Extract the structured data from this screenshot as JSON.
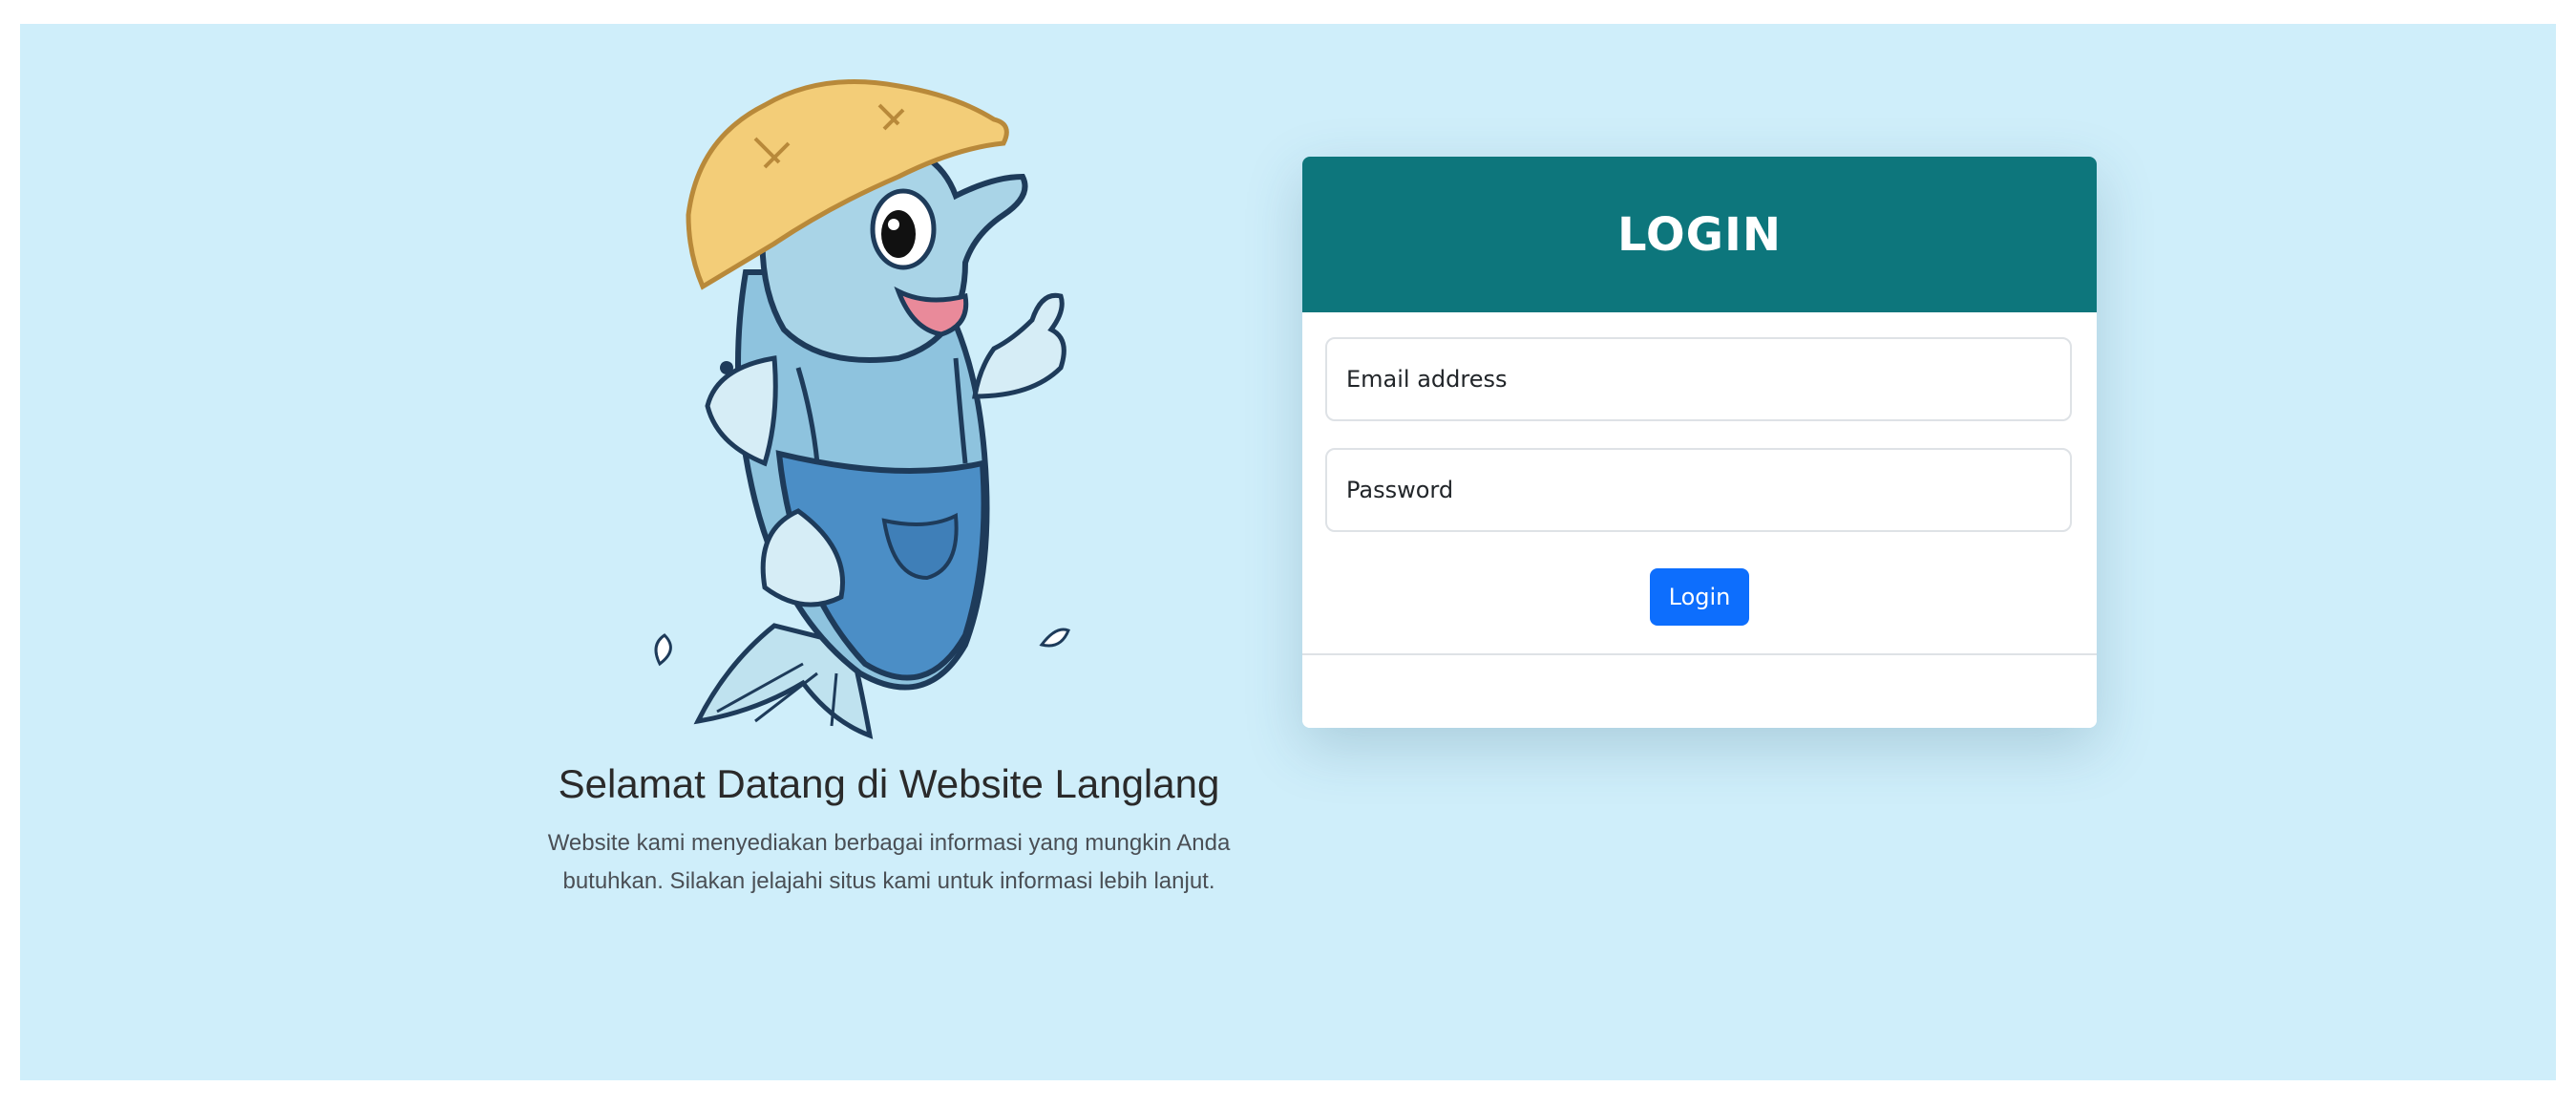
{
  "welcome": {
    "title": "Selamat Datang di Website Langlang",
    "description": "Website kami menyediakan berbagai informasi yang mungkin Anda butuhkan. Silakan jelajahi situs kami untuk informasi lebih lanjut.",
    "mascot_icon": "fish-mascot-with-straw-hat-icon"
  },
  "login": {
    "title": "LOGIN",
    "email_placeholder": "Email address",
    "email_value": "",
    "password_placeholder": "Password",
    "password_value": "",
    "button_label": "Login"
  },
  "colors": {
    "page_background": "#cfeefa",
    "header": "#0d767c",
    "button": "#0d6efd"
  }
}
